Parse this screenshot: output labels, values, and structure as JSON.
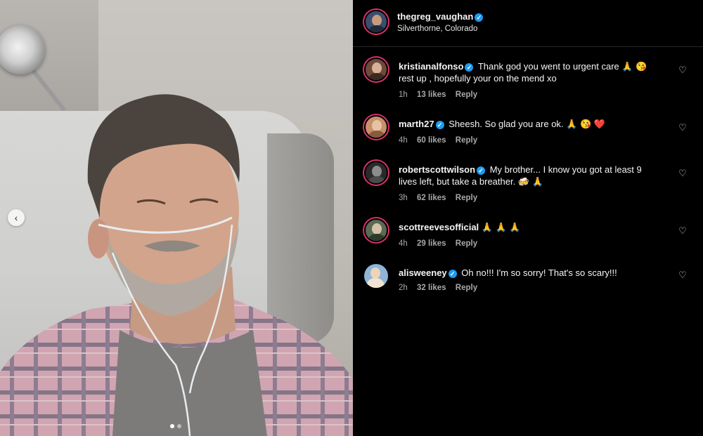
{
  "post": {
    "username": "thegreg_vaughan",
    "location": "Silverthorne, Colorado"
  },
  "carousel": {
    "dots": 2,
    "active_index": 0
  },
  "comments": [
    {
      "username": "kristianalfonso",
      "verified": true,
      "text": "Thank god you went to urgent care 🙏 😘 rest up , hopefully your on the mend xo",
      "time": "1h",
      "likes": "13 likes",
      "reply": "Reply"
    },
    {
      "username": "marth27",
      "verified": true,
      "text": "Sheesh. So glad you are ok. 🙏 😘 ❤️",
      "time": "4h",
      "likes": "60 likes",
      "reply": "Reply"
    },
    {
      "username": "robertscottwilson",
      "verified": true,
      "text": "My brother... I know you got at least 9 lives left, but take a breather. 🍻 🙏",
      "time": "3h",
      "likes": "62 likes",
      "reply": "Reply"
    },
    {
      "username": "scottreevesofficial",
      "verified": false,
      "text": "🙏 🙏 🙏",
      "time": "4h",
      "likes": "29 likes",
      "reply": "Reply"
    },
    {
      "username": "alisweeney",
      "verified": true,
      "text": "Oh no!!! I'm so sorry! That's so scary!!!",
      "time": "2h",
      "likes": "32 likes",
      "reply": "Reply"
    }
  ],
  "icons": {
    "verified": "verified-badge-icon",
    "like": "heart-outline-icon",
    "carousel_prev": "chevron-left-icon"
  },
  "colors": {
    "accent_blue": "#1d9bf0",
    "story_ring": "#d9316a",
    "background": "#000000",
    "meta_text": "#a8a8a8"
  }
}
